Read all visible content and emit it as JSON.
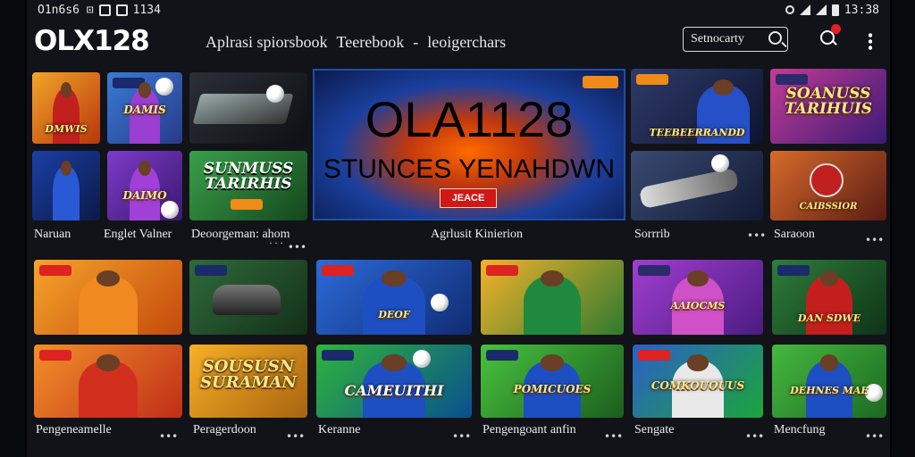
{
  "status_bar": {
    "left_text": "O1n6s6 ⊡",
    "time_left": "1134",
    "time_right": "13:38"
  },
  "app": {
    "logo": "OLX128"
  },
  "nav": {
    "items": [
      "Aplrasi spiorsbook",
      "Teerebook",
      "-",
      "leoigerchars"
    ]
  },
  "search": {
    "placeholder": "Setnocarty"
  },
  "hero": {
    "title": "OLA1128",
    "subtitle": "STUNCES YENAHDWN",
    "button": "JEACE"
  },
  "tiles": [
    {
      "text": "DMWIS",
      "colors": [
        "#f2a52a",
        "#b8360c"
      ]
    },
    {
      "text": "DAMIS",
      "colors": [
        "#3a7bd5",
        "#283a8a"
      ]
    },
    {
      "text": "",
      "colors": [
        "#2b2f36",
        "#0e1014"
      ]
    },
    {
      "text": "",
      "colors": [
        "#1a3fa6",
        "#0c1a46"
      ]
    },
    {
      "text": "DAIMO",
      "colors": [
        "#7d3bc9",
        "#3b1870"
      ]
    },
    {
      "text": "SUNMUSS TARIRHIS",
      "colors": [
        "#3aa04a",
        "#14471d"
      ]
    },
    {
      "text": "TEEBEERRANDD",
      "colors": [
        "#2f3b6a",
        "#0d1430"
      ]
    },
    {
      "text": "SOANUSS TARIHUIS",
      "colors": [
        "#c23c95",
        "#3c1a75"
      ]
    },
    {
      "text": "",
      "colors": [
        "#3a4a72",
        "#111a33"
      ]
    },
    {
      "text": "CAIBSSIOR",
      "colors": [
        "#d86a2a",
        "#5a1c14"
      ]
    }
  ],
  "row1_labels": [
    {
      "label": "Naruan",
      "dots": ""
    },
    {
      "label": "Englet Valner",
      "dots": ""
    },
    {
      "label": "Deoorgeman: ahom",
      "dots": "˙˙˙ •••"
    },
    {
      "label": "Agrlusit Kinierion",
      "dots": ""
    },
    {
      "label": "Sorrrib",
      "dots": "•••"
    },
    {
      "label": "Saraoon",
      "dots": "•••"
    }
  ],
  "row2": [
    {
      "text": "",
      "colors": [
        "#f5a32a",
        "#c44a0d"
      ]
    },
    {
      "text": "",
      "colors": [
        "#2f6a3a",
        "#143019"
      ]
    },
    {
      "text": "DEOF",
      "colors": [
        "#2c6ad8",
        "#102c74"
      ]
    },
    {
      "text": "",
      "colors": [
        "#f3b22a",
        "#2f7a2f"
      ]
    },
    {
      "text": "AAIOCMS",
      "colors": [
        "#a13ed0",
        "#4a1c82"
      ]
    },
    {
      "text": "DAN SDWE",
      "colors": [
        "#2e7d3a",
        "#0f3318"
      ]
    }
  ],
  "row3": [
    {
      "text": "",
      "colors": [
        "#f2902a",
        "#c02e18"
      ]
    },
    {
      "text": "SOUSUSN SURAMAN",
      "colors": [
        "#f7b025",
        "#a86410"
      ]
    },
    {
      "text": "CAMEUITHI",
      "colors": [
        "#2fb53a",
        "#0a4f8f"
      ]
    },
    {
      "text": "POMICUOES",
      "colors": [
        "#48c23e",
        "#1b5e1e"
      ]
    },
    {
      "text": "COMKOUOUUS",
      "colors": [
        "#2d5fc9",
        "#1aa63a"
      ]
    },
    {
      "text": "DEHNES MAE",
      "colors": [
        "#46b83f",
        "#1c6a22"
      ]
    }
  ],
  "row3_labels": [
    {
      "label": "Pengeneamelle",
      "dots": "•••"
    },
    {
      "label": "Peragerdoon",
      "dots": "•••"
    },
    {
      "label": "Keranne",
      "dots": "•••"
    },
    {
      "label": "Pengengoant anfin",
      "dots": "•••"
    },
    {
      "label": "Sengate",
      "dots": "•••"
    },
    {
      "label": "Mencfung",
      "dots": "•••"
    }
  ],
  "accent": "#f08a18"
}
